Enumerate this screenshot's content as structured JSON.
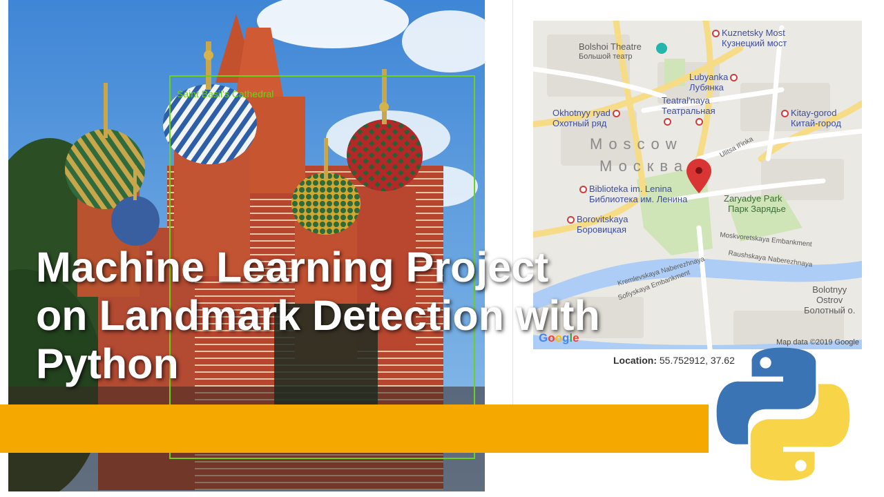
{
  "photo": {
    "detection_label": "Saint Basil's Cathedral",
    "box_color": "#6bd11a"
  },
  "map": {
    "labels": {
      "bolshoi_en": "Bolshoi Theatre",
      "bolshoi_ru": "Большой театр",
      "kuznetsky_en": "Kuznetsky Most",
      "kuznetsky_ru": "Кузнецкий мост",
      "lubyanka_en": "Lubyanka",
      "lubyanka_ru": "Лубянка",
      "teatralnaya_en": "Teatral'naya",
      "teatralnaya_ru": "Театральная",
      "okhotny_en": "Okhotnyy ryad",
      "okhotny_ru": "Охотный ряд",
      "kitay_en": "Kitay-gorod",
      "kitay_ru": "Китай-город",
      "city_en": "Moscow",
      "city_ru": "Москва",
      "ulitsa": "Ulitsa Il'inka",
      "biblioteka_en": "Biblioteka im. Lenina",
      "biblioteka_ru": "Библиотека им. Ленина",
      "zaryadye_en": "Zaryadye Park",
      "zaryadye_ru": "Парк Зарядье",
      "borovitskaya_en": "Borovitskaya",
      "borovitskaya_ru": "Боровицкая",
      "moskvoretskaya": "Moskvoretskaya Embankment",
      "kremlevskaya": "Kremlevskaya Naberezhnaya",
      "raushskaya": "Raushskaya Naberezhnaya",
      "sofiyskaya": "Sofiyskaya Embankment",
      "bolotnyy_en_1": "Bolotnyy",
      "bolotnyy_en_2": "Ostrov",
      "bolotnyy_ru": "Болотный о.",
      "google": "Google",
      "attribution": "Map data ©2019 Google"
    },
    "location_label": "Location:",
    "location_value": "55.752912, 37.62"
  },
  "title": {
    "line1": "Machine Learning Project",
    "line2": "on Landmark Detection with",
    "line3": "Python"
  },
  "colors": {
    "accent_bar": "#f5a800",
    "python_blue": "#3b74b4",
    "python_yellow": "#f8d548",
    "map_pin": "#d93535"
  }
}
